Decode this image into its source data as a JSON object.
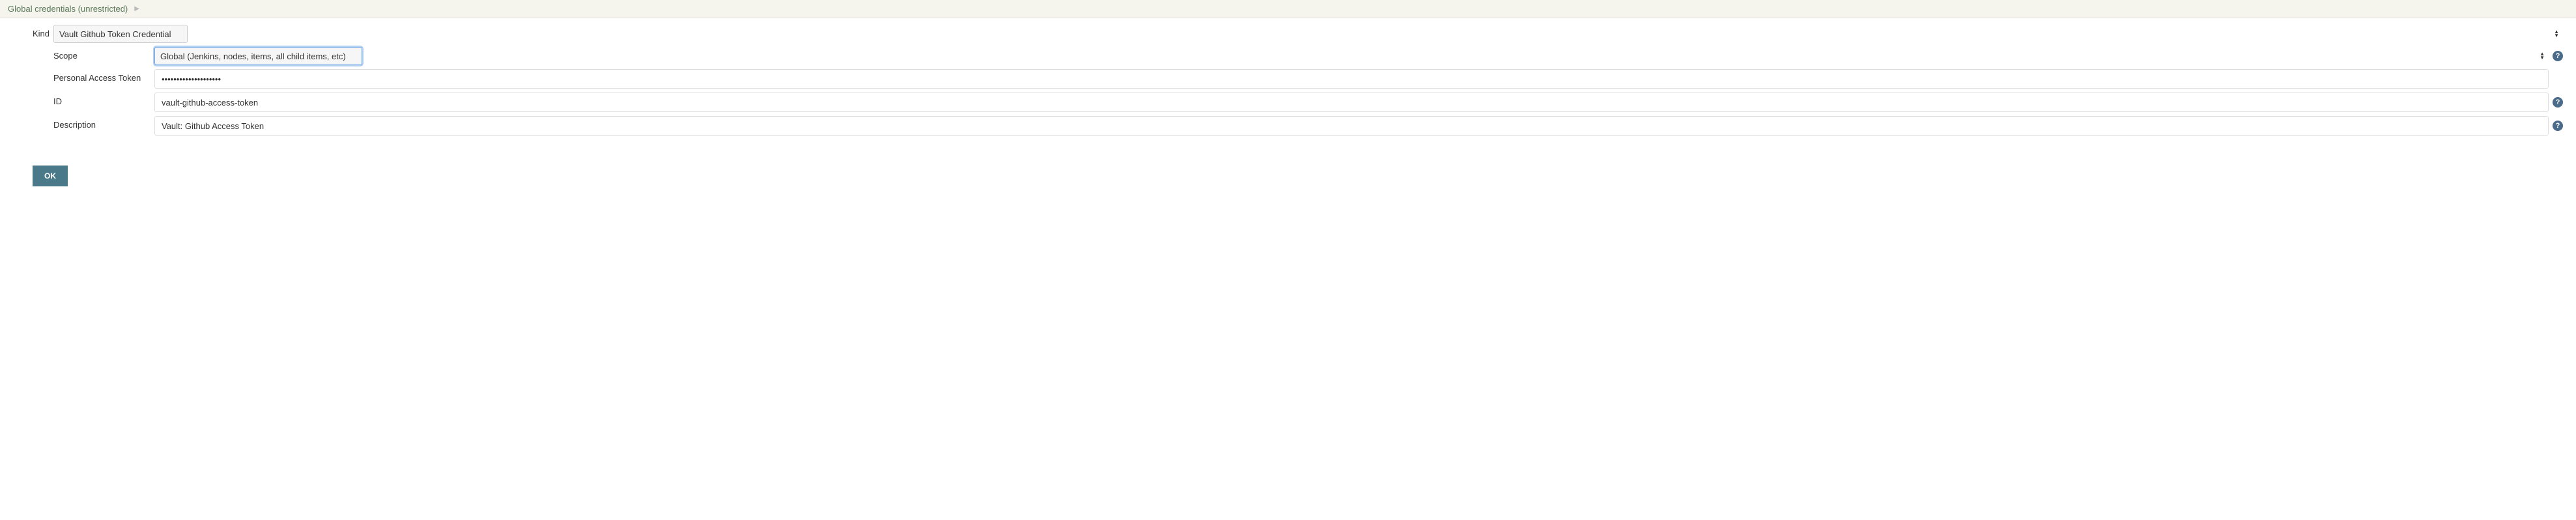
{
  "breadcrumb": {
    "label": "Global credentials (unrestricted)",
    "separator": "▶"
  },
  "form": {
    "kind": {
      "label": "Kind",
      "value": "Vault Github Token Credential"
    },
    "scope": {
      "label": "Scope",
      "value": "Global (Jenkins, nodes, items, all child items, etc)"
    },
    "personalAccessToken": {
      "label": "Personal Access Token",
      "value": "••••••••••••••••••••"
    },
    "id": {
      "label": "ID",
      "value": "vault-github-access-token"
    },
    "description": {
      "label": "Description",
      "value": "Vault: Github Access Token"
    }
  },
  "buttons": {
    "ok": "OK"
  },
  "help": "?"
}
